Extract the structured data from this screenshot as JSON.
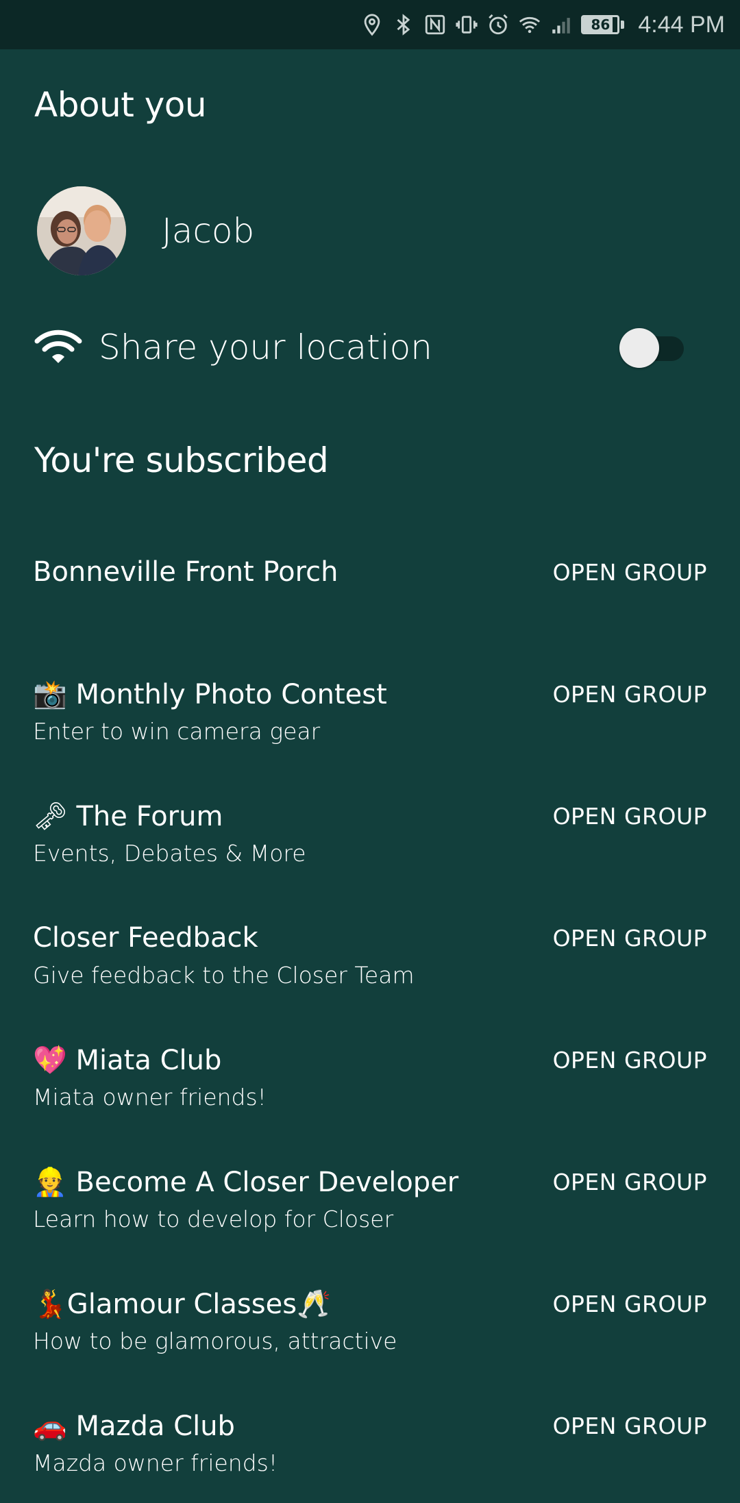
{
  "status_bar": {
    "battery_level": "86",
    "battery_fraction": 0.86,
    "time": "4:44 PM",
    "icons": [
      "location-icon",
      "bluetooth-icon",
      "nfc-icon",
      "vibrate-icon",
      "alarm-icon",
      "wifi-icon",
      "signal-icon",
      "battery-icon"
    ]
  },
  "about": {
    "title": "About you",
    "user_name": "Jacob",
    "share_location_label": "Share your location",
    "share_location_enabled": false
  },
  "subscribed": {
    "title": "You're subscribed",
    "action_label": "OPEN GROUP",
    "groups": [
      {
        "title": "Bonneville Front Porch",
        "subtitle": ""
      },
      {
        "title": "📸 Monthly Photo Contest",
        "subtitle": "Enter to win camera gear"
      },
      {
        "title": "🗝 The Forum",
        "subtitle": "Events, Debates & More"
      },
      {
        "title": "Closer Feedback",
        "subtitle": "Give feedback to the Closer Team"
      },
      {
        "title": "💖 Miata Club",
        "subtitle": "Miata owner friends!"
      },
      {
        "title": "👷 Become A Closer Developer",
        "subtitle": "Learn how to develop for Closer"
      },
      {
        "title": "💃Glamour Classes🥂",
        "subtitle": "How to be glamorous, attractive"
      },
      {
        "title": "🚗 Mazda Club",
        "subtitle": "Mazda owner friends!"
      }
    ]
  },
  "colors": {
    "background": "#123f3c",
    "status_bar": "#0c2826",
    "text": "#ffffff"
  }
}
